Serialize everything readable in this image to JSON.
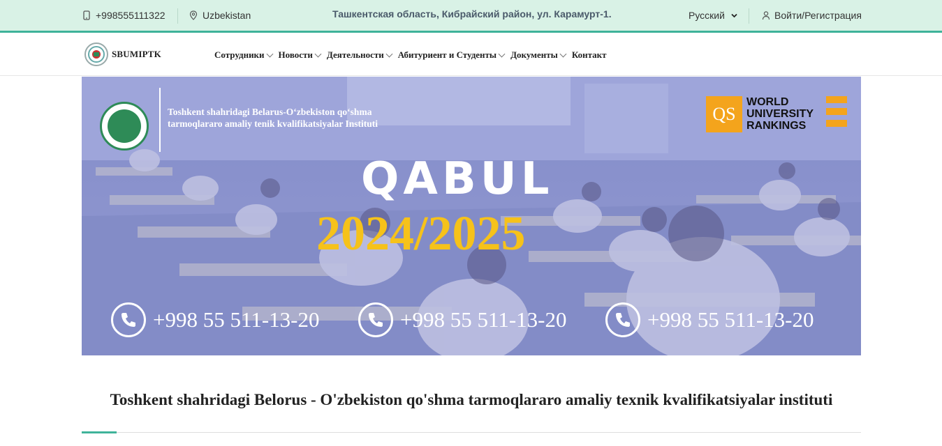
{
  "topbar": {
    "phone": "+998555111322",
    "country": "Uzbekistan",
    "address": "Ташкентская область, Кибрайский район, ул. Карамурт-1.",
    "language": "Русский",
    "login": "Войти/Регистрация"
  },
  "nav": {
    "logo_text": "SBUMIPTK",
    "items": [
      {
        "label": "Сотрудники",
        "has_dropdown": true
      },
      {
        "label": "Новости",
        "has_dropdown": true
      },
      {
        "label": "Деятельности",
        "has_dropdown": true
      },
      {
        "label": "Абитуриент и Студенты",
        "has_dropdown": true
      },
      {
        "label": "Документы",
        "has_dropdown": true
      },
      {
        "label": "Контакт",
        "has_dropdown": false
      }
    ]
  },
  "banner": {
    "institute_name": "Toshkent shahridagi Belarus-O‘zbekiston qo‘shma tarmoqlararo amaliy tenik kvalifikatsiyalar Instituti",
    "qs_logo": "QS",
    "qs_text_1": "WORLD",
    "qs_text_2": "UNIVERSITY",
    "qs_text_3": "RANKINGS",
    "title": "QABUL",
    "year": "2024/2025",
    "phones": [
      "+998 55 511-13-20",
      "+998 55 511-13-20",
      "+998 55 511-13-20"
    ]
  },
  "main": {
    "heading": "Toshkent shahridagi Belorus - O'zbekiston qo'shma tarmoqlararo amaliy texnik kvalifikatsiyalar instituti"
  },
  "colors": {
    "accent": "#3fb39a",
    "topbar_bg": "#d9f2e6",
    "year_gold": "#f6c21a",
    "qs_orange": "#f4a41c"
  }
}
